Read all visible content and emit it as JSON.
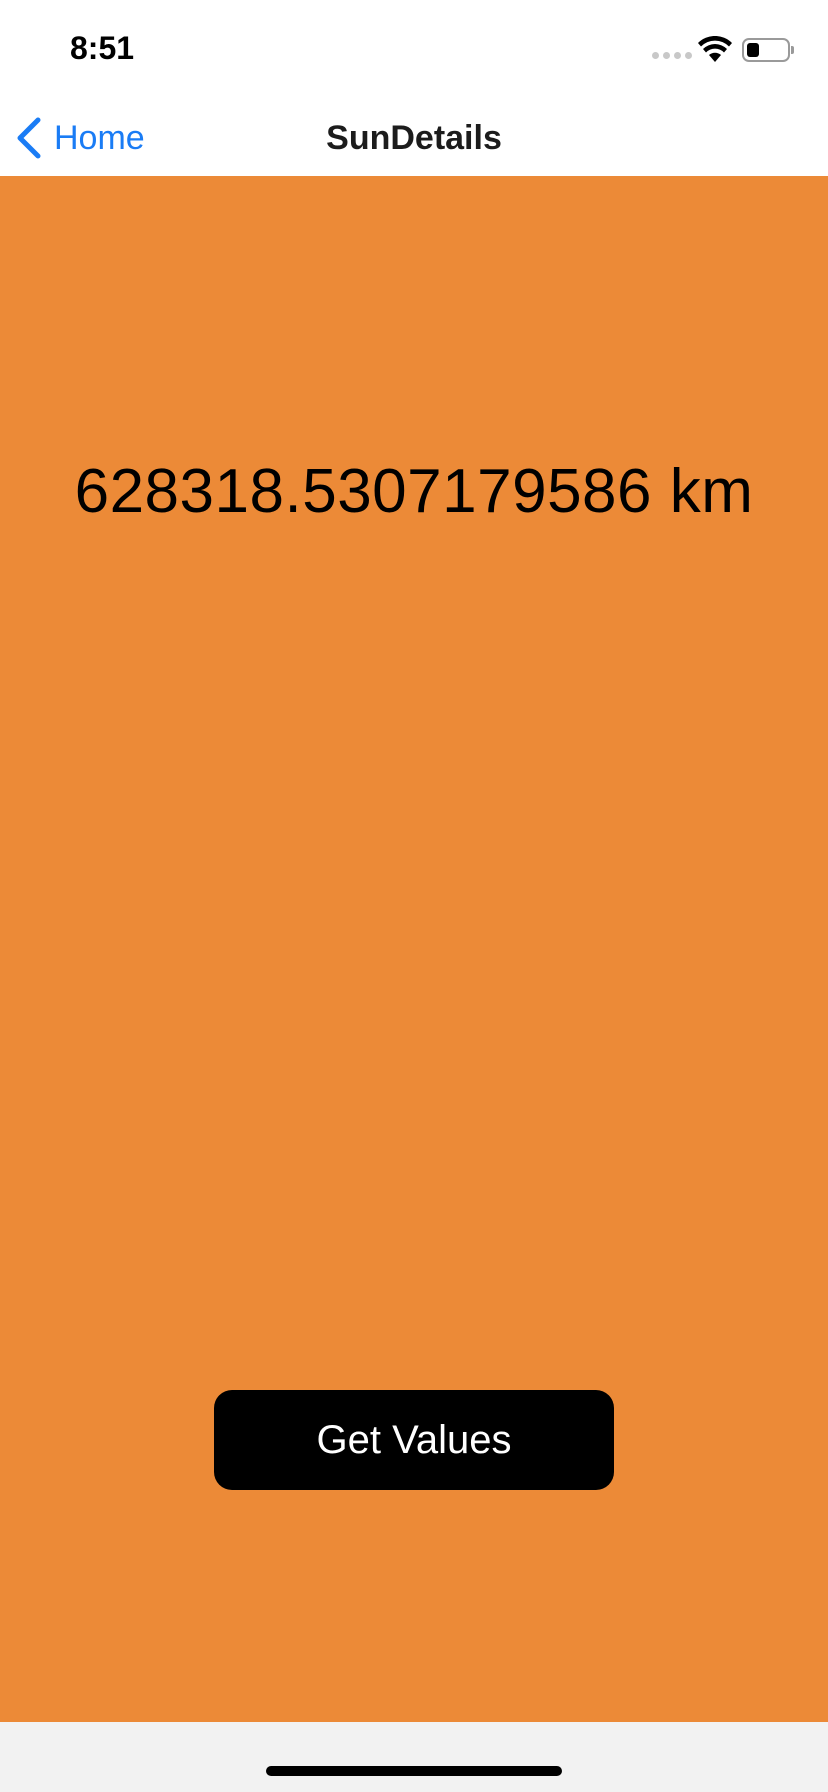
{
  "status_bar": {
    "time": "8:51",
    "icons": [
      "cellular-signal-icon",
      "wifi-icon",
      "battery-icon"
    ]
  },
  "nav": {
    "back_label": "Home",
    "title": "SunDetails",
    "accent_color": "#1a7cf5"
  },
  "content": {
    "background_color": "#ec8a37",
    "value_text": "628318.5307179586 km",
    "button_label": "Get Values"
  }
}
